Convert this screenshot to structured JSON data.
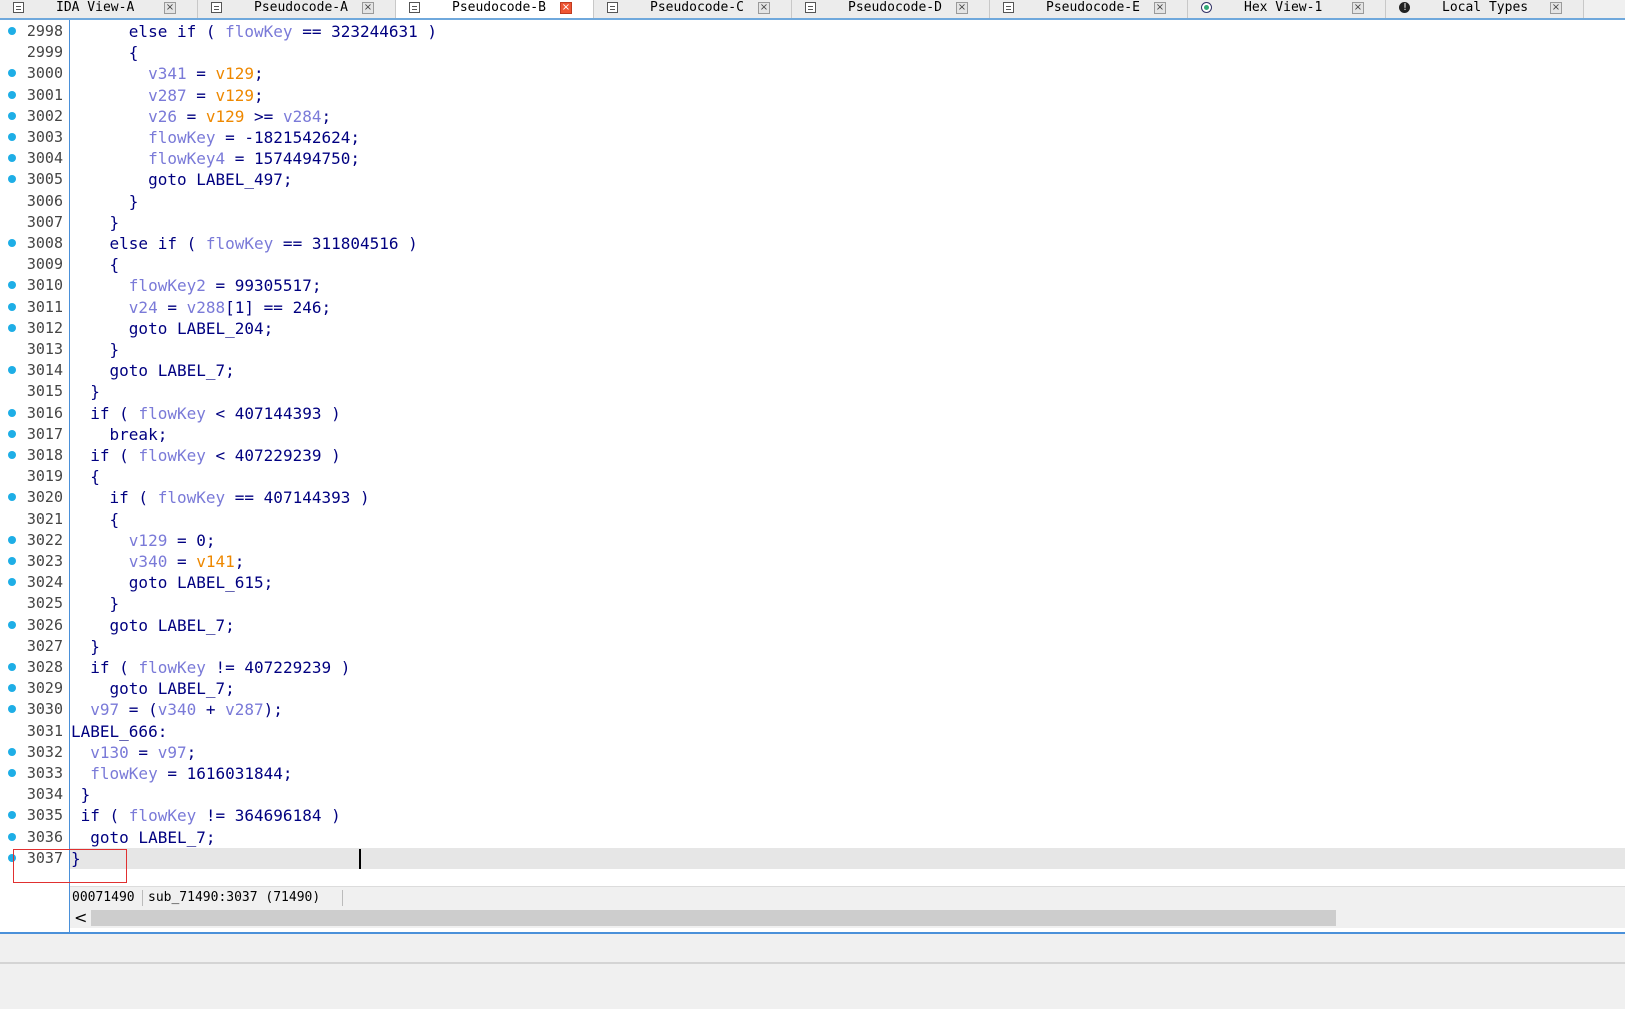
{
  "tabs": [
    {
      "label": "IDA View-A",
      "icon": "doc-icon",
      "active": false
    },
    {
      "label": "Pseudocode-A",
      "icon": "doc-icon",
      "active": false
    },
    {
      "label": "Pseudocode-B",
      "icon": "doc-icon",
      "active": true
    },
    {
      "label": "Pseudocode-C",
      "icon": "doc-icon",
      "active": false
    },
    {
      "label": "Pseudocode-D",
      "icon": "doc-icon",
      "active": false
    },
    {
      "label": "Pseudocode-E",
      "icon": "doc-icon",
      "active": false
    },
    {
      "label": "Hex View-1",
      "icon": "hex-icon",
      "active": false
    },
    {
      "label": "Local Types",
      "icon": "types-icon",
      "active": false
    }
  ],
  "close_glyph": "×",
  "colors": {
    "variable": "#7a7ad8",
    "global": "#ee8800",
    "keyword": "#000080",
    "breakpoint_dot": "#1eaee6",
    "current_line": "#e6e6e6"
  },
  "code_lines": [
    {
      "n": "2998",
      "dot": true,
      "tokens": [
        [
          "k",
          "      else if ( "
        ],
        [
          "v",
          "flowKey"
        ],
        [
          "k",
          " == 323244631 )"
        ]
      ]
    },
    {
      "n": "2999",
      "dot": false,
      "tokens": [
        [
          "k",
          "      {"
        ]
      ]
    },
    {
      "n": "3000",
      "dot": true,
      "tokens": [
        [
          "k",
          "        "
        ],
        [
          "v",
          "v341"
        ],
        [
          "k",
          " = "
        ],
        [
          "g",
          "v129"
        ],
        [
          "k",
          ";"
        ]
      ]
    },
    {
      "n": "3001",
      "dot": true,
      "tokens": [
        [
          "k",
          "        "
        ],
        [
          "v",
          "v287"
        ],
        [
          "k",
          " = "
        ],
        [
          "g",
          "v129"
        ],
        [
          "k",
          ";"
        ]
      ]
    },
    {
      "n": "3002",
      "dot": true,
      "tokens": [
        [
          "k",
          "        "
        ],
        [
          "v",
          "v26"
        ],
        [
          "k",
          " = "
        ],
        [
          "g",
          "v129"
        ],
        [
          "k",
          " >= "
        ],
        [
          "v",
          "v284"
        ],
        [
          "k",
          ";"
        ]
      ]
    },
    {
      "n": "3003",
      "dot": true,
      "tokens": [
        [
          "k",
          "        "
        ],
        [
          "v",
          "flowKey"
        ],
        [
          "k",
          " = -1821542624;"
        ]
      ]
    },
    {
      "n": "3004",
      "dot": true,
      "tokens": [
        [
          "k",
          "        "
        ],
        [
          "v",
          "flowKey4"
        ],
        [
          "k",
          " = 1574494750;"
        ]
      ]
    },
    {
      "n": "3005",
      "dot": true,
      "tokens": [
        [
          "k",
          "        goto LABEL_497;"
        ]
      ]
    },
    {
      "n": "3006",
      "dot": false,
      "tokens": [
        [
          "k",
          "      }"
        ]
      ]
    },
    {
      "n": "3007",
      "dot": false,
      "tokens": [
        [
          "k",
          "    }"
        ]
      ]
    },
    {
      "n": "3008",
      "dot": true,
      "tokens": [
        [
          "k",
          "    else if ( "
        ],
        [
          "v",
          "flowKey"
        ],
        [
          "k",
          " == 311804516 )"
        ]
      ]
    },
    {
      "n": "3009",
      "dot": false,
      "tokens": [
        [
          "k",
          "    {"
        ]
      ]
    },
    {
      "n": "3010",
      "dot": true,
      "tokens": [
        [
          "k",
          "      "
        ],
        [
          "v",
          "flowKey2"
        ],
        [
          "k",
          " = 99305517;"
        ]
      ]
    },
    {
      "n": "3011",
      "dot": true,
      "tokens": [
        [
          "k",
          "      "
        ],
        [
          "v",
          "v24"
        ],
        [
          "k",
          " = "
        ],
        [
          "v",
          "v288"
        ],
        [
          "k",
          "[1] == 246;"
        ]
      ]
    },
    {
      "n": "3012",
      "dot": true,
      "tokens": [
        [
          "k",
          "      goto LABEL_204;"
        ]
      ]
    },
    {
      "n": "3013",
      "dot": false,
      "tokens": [
        [
          "k",
          "    }"
        ]
      ]
    },
    {
      "n": "3014",
      "dot": true,
      "tokens": [
        [
          "k",
          "    goto LABEL_7;"
        ]
      ]
    },
    {
      "n": "3015",
      "dot": false,
      "tokens": [
        [
          "k",
          "  }"
        ]
      ]
    },
    {
      "n": "3016",
      "dot": true,
      "tokens": [
        [
          "k",
          "  if ( "
        ],
        [
          "v",
          "flowKey"
        ],
        [
          "k",
          " < 407144393 )"
        ]
      ]
    },
    {
      "n": "3017",
      "dot": true,
      "tokens": [
        [
          "k",
          "    break;"
        ]
      ]
    },
    {
      "n": "3018",
      "dot": true,
      "tokens": [
        [
          "k",
          "  if ( "
        ],
        [
          "v",
          "flowKey"
        ],
        [
          "k",
          " < 407229239 )"
        ]
      ]
    },
    {
      "n": "3019",
      "dot": false,
      "tokens": [
        [
          "k",
          "  {"
        ]
      ]
    },
    {
      "n": "3020",
      "dot": true,
      "tokens": [
        [
          "k",
          "    if ( "
        ],
        [
          "v",
          "flowKey"
        ],
        [
          "k",
          " == 407144393 )"
        ]
      ]
    },
    {
      "n": "3021",
      "dot": false,
      "tokens": [
        [
          "k",
          "    {"
        ]
      ]
    },
    {
      "n": "3022",
      "dot": true,
      "tokens": [
        [
          "k",
          "      "
        ],
        [
          "v",
          "v129"
        ],
        [
          "k",
          " = 0;"
        ]
      ]
    },
    {
      "n": "3023",
      "dot": true,
      "tokens": [
        [
          "k",
          "      "
        ],
        [
          "v",
          "v340"
        ],
        [
          "k",
          " = "
        ],
        [
          "g",
          "v141"
        ],
        [
          "k",
          ";"
        ]
      ]
    },
    {
      "n": "3024",
      "dot": true,
      "tokens": [
        [
          "k",
          "      goto LABEL_615;"
        ]
      ]
    },
    {
      "n": "3025",
      "dot": false,
      "tokens": [
        [
          "k",
          "    }"
        ]
      ]
    },
    {
      "n": "3026",
      "dot": true,
      "tokens": [
        [
          "k",
          "    goto LABEL_7;"
        ]
      ]
    },
    {
      "n": "3027",
      "dot": false,
      "tokens": [
        [
          "k",
          "  }"
        ]
      ]
    },
    {
      "n": "3028",
      "dot": true,
      "tokens": [
        [
          "k",
          "  if ( "
        ],
        [
          "v",
          "flowKey"
        ],
        [
          "k",
          " != 407229239 )"
        ]
      ]
    },
    {
      "n": "3029",
      "dot": true,
      "tokens": [
        [
          "k",
          "    goto LABEL_7;"
        ]
      ]
    },
    {
      "n": "3030",
      "dot": true,
      "tokens": [
        [
          "k",
          "  "
        ],
        [
          "v",
          "v97"
        ],
        [
          "k",
          " = ("
        ],
        [
          "v",
          "v340"
        ],
        [
          "k",
          " + "
        ],
        [
          "v",
          "v287"
        ],
        [
          "k",
          ");"
        ]
      ]
    },
    {
      "n": "3031",
      "dot": false,
      "tokens": [
        [
          "k",
          "LABEL_666:"
        ]
      ]
    },
    {
      "n": "3032",
      "dot": true,
      "tokens": [
        [
          "k",
          "  "
        ],
        [
          "v",
          "v130"
        ],
        [
          "k",
          " = "
        ],
        [
          "v",
          "v97"
        ],
        [
          "k",
          ";"
        ]
      ]
    },
    {
      "n": "3033",
      "dot": true,
      "tokens": [
        [
          "k",
          "  "
        ],
        [
          "v",
          "flowKey"
        ],
        [
          "k",
          " = 1616031844;"
        ]
      ]
    },
    {
      "n": "3034",
      "dot": false,
      "tokens": [
        [
          "k",
          " }"
        ]
      ]
    },
    {
      "n": "3035",
      "dot": true,
      "tokens": [
        [
          "k",
          " if ( "
        ],
        [
          "v",
          "flowKey"
        ],
        [
          "k",
          " != 364696184 )"
        ]
      ]
    },
    {
      "n": "3036",
      "dot": true,
      "tokens": [
        [
          "k",
          "  goto LABEL_7;"
        ]
      ]
    },
    {
      "n": "3037",
      "dot": true,
      "tokens": [
        [
          "k",
          "}"
        ]
      ]
    }
  ],
  "status": {
    "address": "00071490",
    "location": "sub_71490:3037 (71490)"
  },
  "scroll": {
    "left_arrow": "<"
  }
}
